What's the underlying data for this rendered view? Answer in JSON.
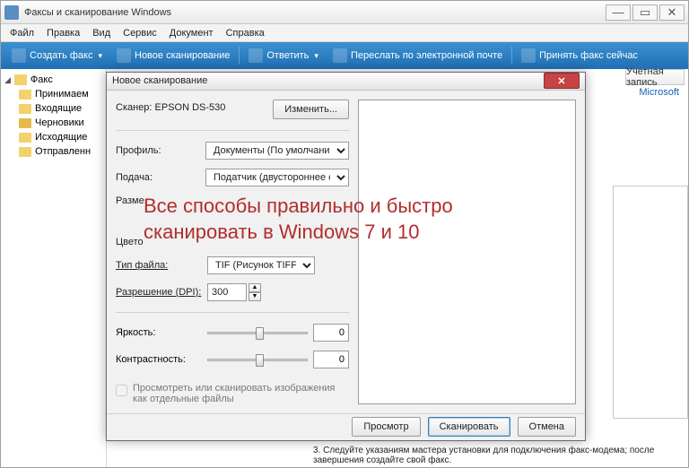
{
  "window": {
    "title": "Факсы и сканирование Windows",
    "min": "—",
    "max": "▭",
    "close": "✕"
  },
  "menu": {
    "file": "Файл",
    "edit": "Правка",
    "view": "Вид",
    "service": "Сервис",
    "document": "Документ",
    "help": "Справка"
  },
  "toolbar": {
    "new_fax": "Создать факс",
    "new_scan": "Новое сканирование",
    "reply": "Ответить",
    "forward": "Переслать по электронной почте",
    "receive_now": "Принять факс сейчас"
  },
  "tree": {
    "root": "Факс",
    "items": [
      "Принимаем",
      "Входящие",
      "Черновики",
      "Исходящие",
      "Отправленн"
    ]
  },
  "columns": {
    "account": "Учетная запись"
  },
  "account_value": "Microsoft",
  "footnote": "3.    Следуйте указаниям мастера установки для подключения факс-модема; после завершения создайте свой факс.",
  "dialog": {
    "title": "Новое сканирование",
    "scanner_label": "Сканер:",
    "scanner_value": "EPSON DS-530",
    "change_btn": "Изменить...",
    "profile_label": "Профиль:",
    "profile_value": "Документы (По умолчанию)",
    "feed_label": "Подача:",
    "feed_value": "Податчик (двустороннее сканир",
    "size_label": "Разме",
    "color_label": "Цвето",
    "filetype_label": "Тип файла:",
    "filetype_value": "TIF (Рисунок TIFF)",
    "dpi_label": "Разрешение (DPI):",
    "dpi_value": "300",
    "brightness_label": "Яркость:",
    "brightness_value": "0",
    "contrast_label": "Контрастность:",
    "contrast_value": "0",
    "checkbox_label": "Просмотреть или сканировать изображения как отдельные файлы",
    "preview_btn": "Просмотр",
    "scan_btn": "Сканировать",
    "cancel_btn": "Отмена"
  },
  "overlay": "Все способы правильно и быстро сканировать в Windows 7 и 10"
}
